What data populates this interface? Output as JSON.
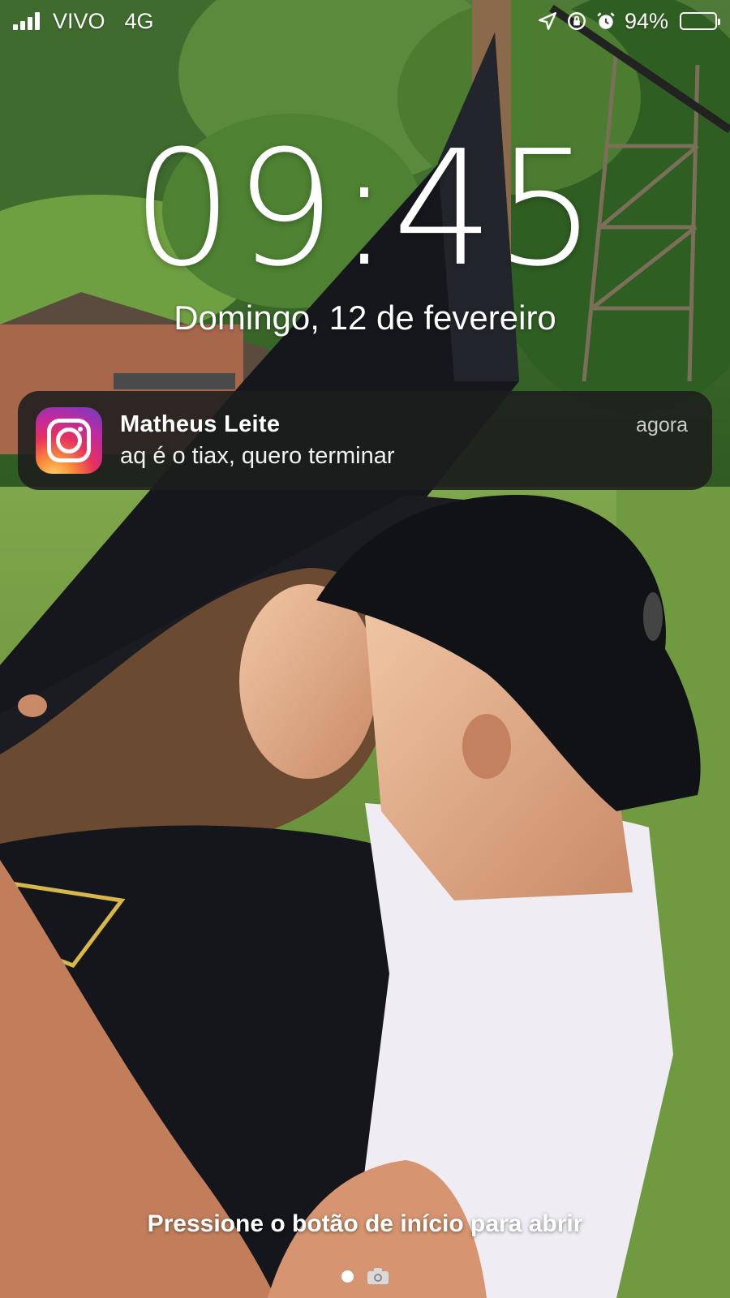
{
  "status_bar": {
    "carrier": "VIVO",
    "network": "4G",
    "battery_percent": "94%",
    "battery_level": 0.94,
    "icons": [
      "signal-icon",
      "location-icon",
      "orientation-lock-icon",
      "alarm-icon",
      "battery-icon"
    ],
    "battery_color": "#f5c518"
  },
  "lock_screen": {
    "time": "09:45",
    "date": "Domingo, 12 de fevereiro",
    "unlock_hint": "Pressione o botão de início para abrir"
  },
  "notification": {
    "app_icon": "instagram-icon",
    "title": "Matheus Leite",
    "time": "agora",
    "message": "aq é o tiax, quero terminar"
  },
  "pager": {
    "icons": [
      "page-dot",
      "camera-icon"
    ]
  }
}
